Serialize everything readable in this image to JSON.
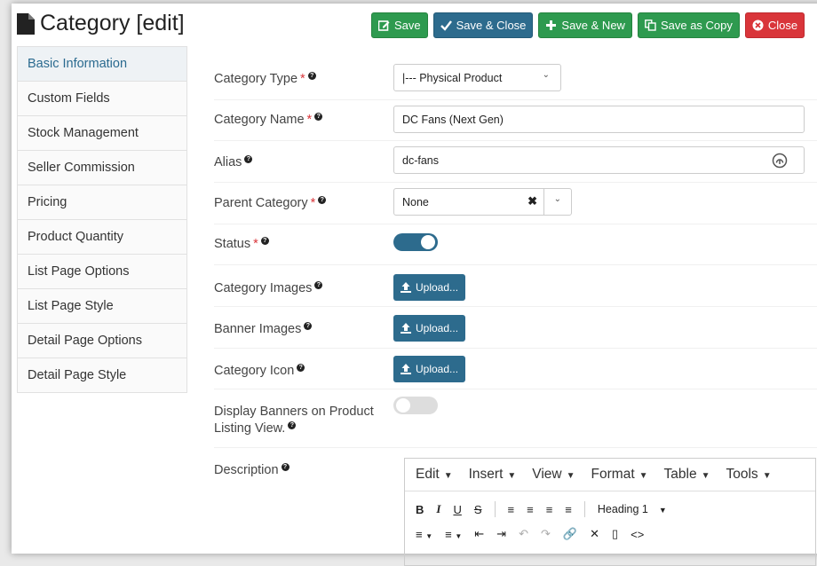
{
  "header": {
    "title": "Category [edit]",
    "buttons": {
      "save": "Save",
      "save_close": "Save & Close",
      "save_new": "Save & New",
      "save_copy": "Save as Copy",
      "close": "Close"
    }
  },
  "sidebar": {
    "items": [
      "Basic Information",
      "Custom Fields",
      "Stock Management",
      "Seller Commission",
      "Pricing",
      "Product Quantity",
      "List Page Options",
      "List Page Style",
      "Detail Page Options",
      "Detail Page Style"
    ],
    "active_index": 0
  },
  "form": {
    "category_type": {
      "label": "Category Type",
      "value": "|--- Physical Product"
    },
    "category_name": {
      "label": "Category Name",
      "value": "DC Fans (Next Gen)"
    },
    "alias": {
      "label": "Alias",
      "value": "dc-fans"
    },
    "parent_category": {
      "label": "Parent Category",
      "value": "None"
    },
    "status": {
      "label": "Status",
      "enabled": true
    },
    "category_images": {
      "label": "Category Images",
      "button": "Upload..."
    },
    "banner_images": {
      "label": "Banner Images",
      "button": "Upload..."
    },
    "category_icon": {
      "label": "Category Icon",
      "button": "Upload..."
    },
    "display_banners": {
      "label_line1": "Display Banners on Product",
      "label_line2": "Listing View.",
      "enabled": false
    },
    "description": {
      "label": "Description"
    }
  },
  "editor": {
    "menus": [
      "Edit",
      "Insert",
      "View",
      "Format",
      "Table",
      "Tools"
    ],
    "format_select": "Heading 1"
  },
  "colors": {
    "primary": "#2d6b8d",
    "success": "#2e9a4f",
    "danger": "#d9353a"
  }
}
